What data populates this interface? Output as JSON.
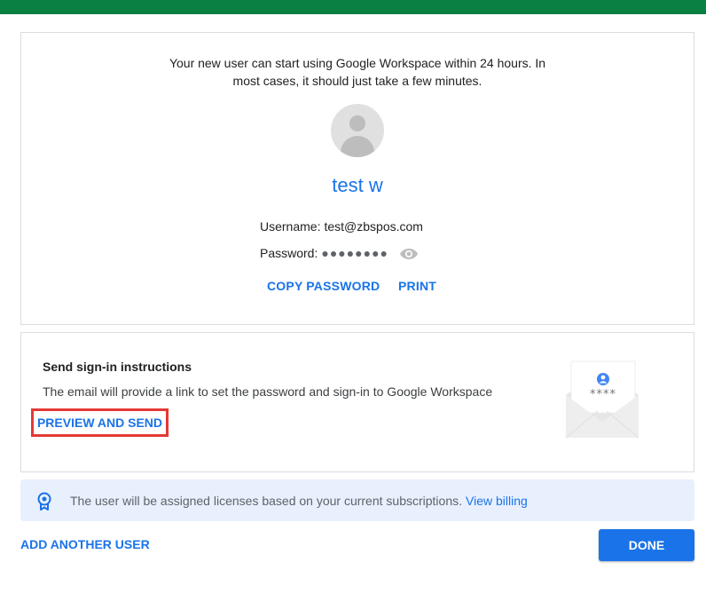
{
  "colors": {
    "top_bar": "#0b8043",
    "link": "#1a73e8",
    "highlight_border": "#e53935",
    "notice_bg": "#e8f0fe"
  },
  "user_card": {
    "intro_line1": "Your new user can start using Google Workspace within 24 hours. In",
    "intro_line2": "most cases, it should just take a few minutes.",
    "avatar_icon": "person-avatar-icon",
    "name": "test w",
    "username_label": "Username:",
    "username_value": "test@zbspos.com",
    "password_label": "Password:",
    "password_masked": "●●●●●●●●",
    "show_password_icon": "eye-icon",
    "copy_password_label": "COPY PASSWORD",
    "print_label": "PRINT"
  },
  "send_card": {
    "title": "Send sign-in instructions",
    "description": "The email will provide a link to set the password and sign-in to Google Workspace",
    "preview_send_label": "PREVIEW AND SEND",
    "illustration_icon": "envelope-icon",
    "illustration_stars": "****"
  },
  "notice": {
    "icon": "license-badge-icon",
    "text": "The user will be assigned licenses based on your current subscriptions.",
    "link": "View billing"
  },
  "footer": {
    "add_another_label": "ADD ANOTHER USER",
    "done_label": "DONE"
  }
}
